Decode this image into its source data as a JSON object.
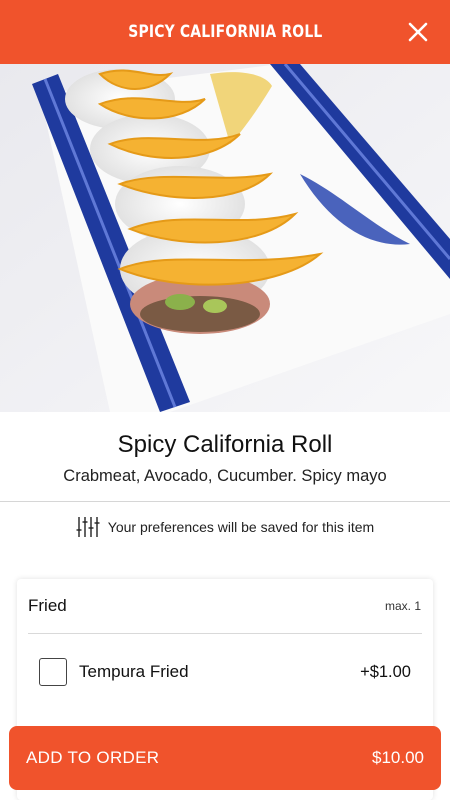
{
  "header": {
    "title": "SPICY CALIFORNIA ROLL",
    "close_icon": "close-icon"
  },
  "hero": {
    "image": "sushi-roll-photo"
  },
  "item": {
    "name": "Spicy California Roll",
    "description": "Crabmeat, Avocado, Cucumber. Spicy mayo"
  },
  "preferences": {
    "icon": "sliders-icon",
    "text": "Your preferences will be saved for this item"
  },
  "option_group": {
    "title": "Fried",
    "max": "max. 1",
    "options": [
      {
        "label": "Tempura Fried",
        "price": "+$1.00",
        "checked": false
      }
    ]
  },
  "cart_button": {
    "label": "ADD TO ORDER",
    "price": "$10.00"
  },
  "colors": {
    "accent": "#f0532c"
  }
}
